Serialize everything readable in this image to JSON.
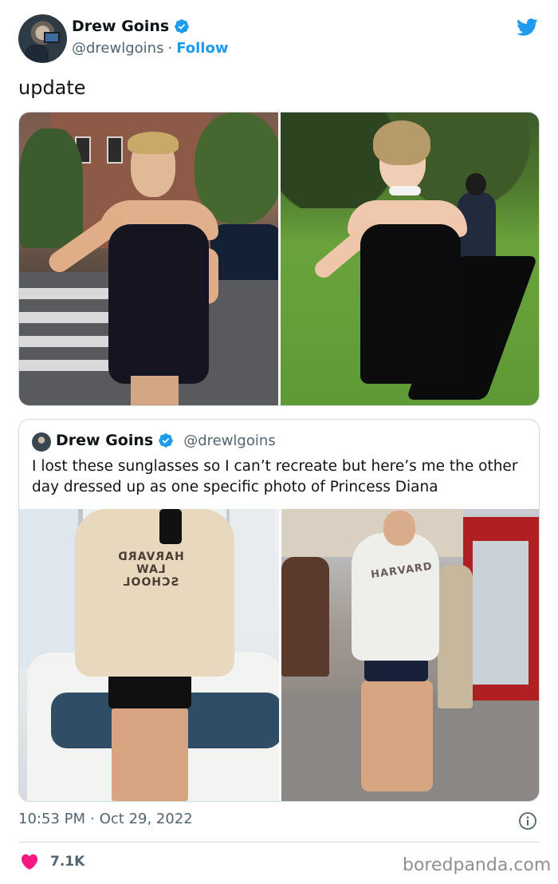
{
  "header": {
    "author_name": "Drew Goins",
    "handle": "@drewlgoins",
    "separator": "·",
    "follow_label": "Follow"
  },
  "tweet": {
    "text": "update"
  },
  "quote": {
    "author_name": "Drew Goins",
    "handle": "@drewlgoins",
    "text": "I lost these sunglasses so I can’t recreate but here’s me the other day dressed up as one specific photo of Princess Diana",
    "sweatshirt_text_1": "HARVARD",
    "sweatshirt_text_2": "LAW SCHOOL",
    "diana_sweatshirt_text": "HARVARD"
  },
  "footer": {
    "time": "10:53 PM",
    "separator": "·",
    "date": "Oct 29, 2022",
    "like_count": "7.1K",
    "watermark": "boredpanda.com"
  },
  "colors": {
    "twitter_blue": "#1d9bf0",
    "like_pink": "#f91880",
    "secondary_text": "#536471"
  },
  "icons": {
    "verified": "verified-badge-icon",
    "logo": "twitter-bird-icon",
    "info": "info-circle-icon",
    "like": "heart-icon"
  }
}
